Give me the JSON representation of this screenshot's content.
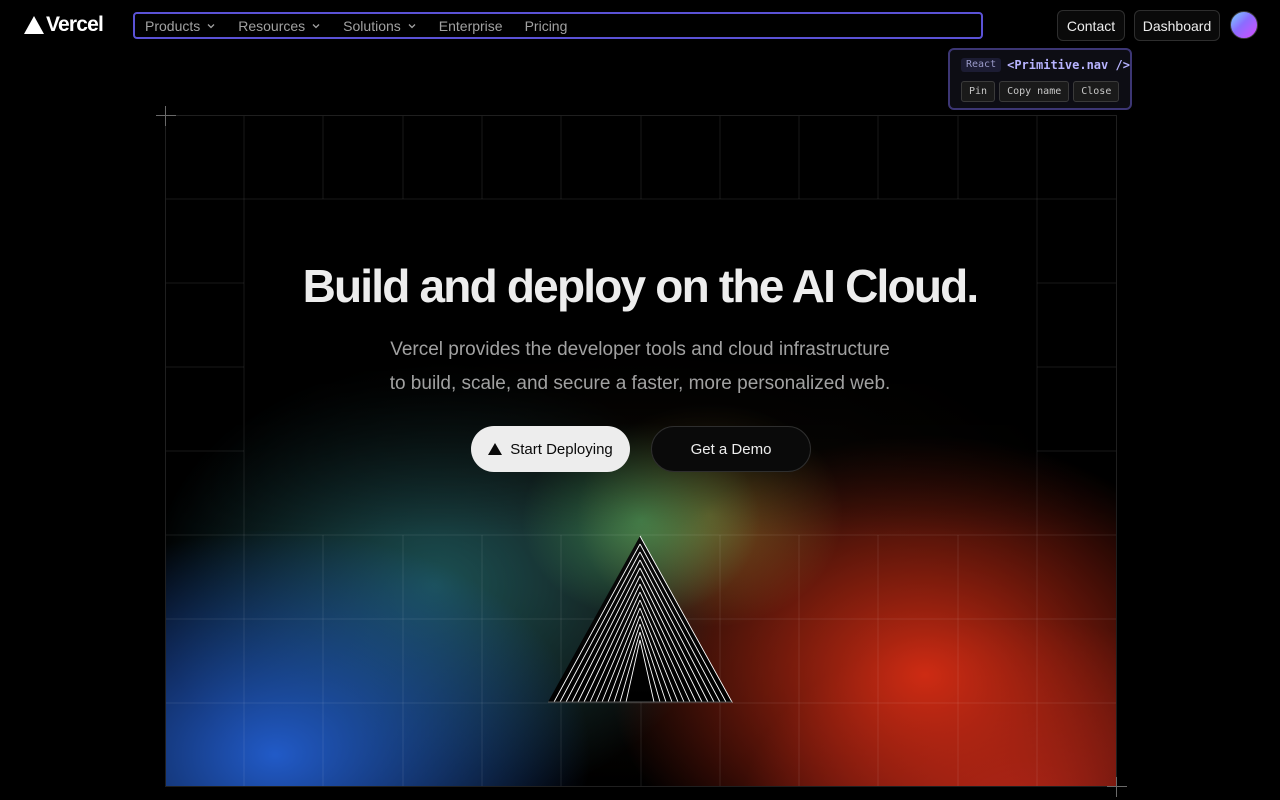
{
  "brand": {
    "name": "Vercel",
    "icon": "vercel-triangle-logo"
  },
  "nav": {
    "items": [
      {
        "label": "Products",
        "dropdown": true
      },
      {
        "label": "Resources",
        "dropdown": true
      },
      {
        "label": "Solutions",
        "dropdown": true
      },
      {
        "label": "Enterprise",
        "dropdown": false
      },
      {
        "label": "Pricing",
        "dropdown": false
      }
    ],
    "highlight_color": "#5b52d6"
  },
  "header_actions": {
    "contact": "Contact",
    "dashboard": "Dashboard",
    "avatar": "user-avatar"
  },
  "inspector": {
    "framework": "React",
    "component": "<Primitive.nav />",
    "buttons": [
      "Pin",
      "Copy name",
      "Close"
    ]
  },
  "hero": {
    "headline": "Build and deploy on the AI Cloud.",
    "subline_1": "Vercel provides the developer tools and cloud infrastructure",
    "subline_2": "to build, scale, and secure a faster, more personalized web.",
    "primary_cta": "Start Deploying",
    "secondary_cta": "Get a Demo"
  },
  "colors": {
    "background": "#000000",
    "text": "#ededed",
    "muted": "#a1a1a1",
    "glow_blue": "#235fd2",
    "glow_green": "#50be6e",
    "glow_red": "#d72d14"
  }
}
